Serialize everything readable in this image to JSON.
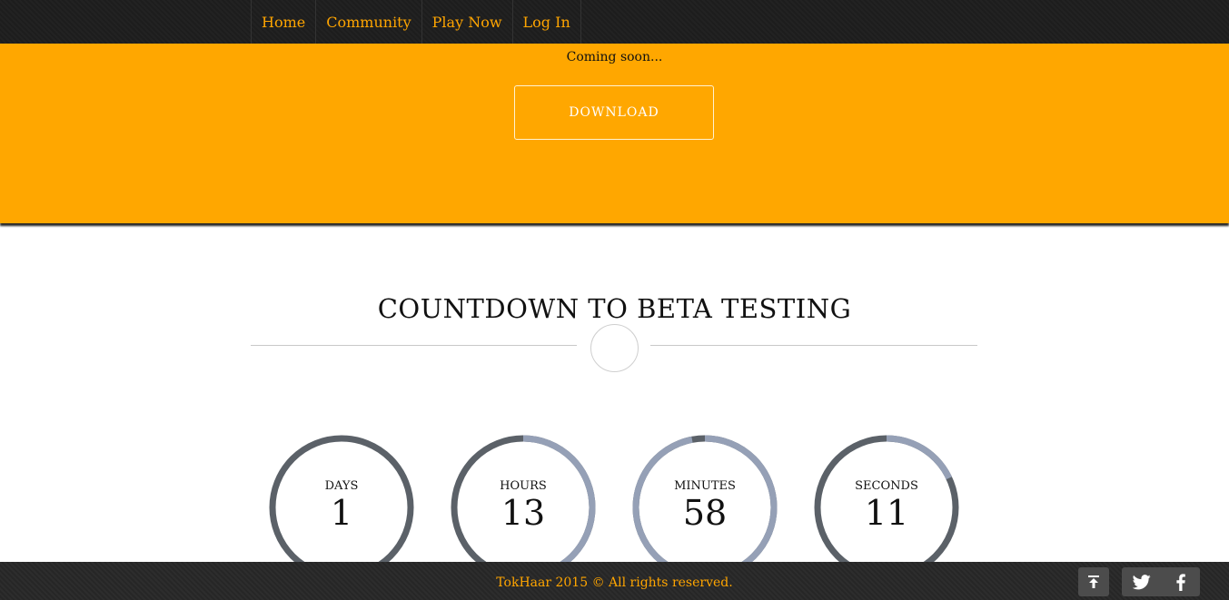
{
  "nav": {
    "items": [
      {
        "label": "Home"
      },
      {
        "label": "Community"
      },
      {
        "label": "Play Now"
      },
      {
        "label": "Log In"
      }
    ]
  },
  "hero": {
    "tagline": "Coming soon...",
    "download_label": "DOWNLOAD",
    "background_color": "#ffa700"
  },
  "countdown": {
    "title": "COUNTDOWN TO BETA TESTING",
    "track_color": "#5b6168",
    "progress_color": "#95a0b6",
    "timers": [
      {
        "label": "DAYS",
        "value": "1",
        "progress": 0
      },
      {
        "label": "HOURS",
        "value": "13",
        "progress": 0.54
      },
      {
        "label": "MINUTES",
        "value": "58",
        "progress": 0.97
      },
      {
        "label": "SECONDS",
        "value": "11",
        "progress": 0.18
      }
    ]
  },
  "footer": {
    "copyright": "TokHaar 2015 © All rights reserved.",
    "text_color": "#ffa500",
    "icons": [
      "arrow-up-icon",
      "twitter-icon",
      "facebook-icon"
    ]
  }
}
